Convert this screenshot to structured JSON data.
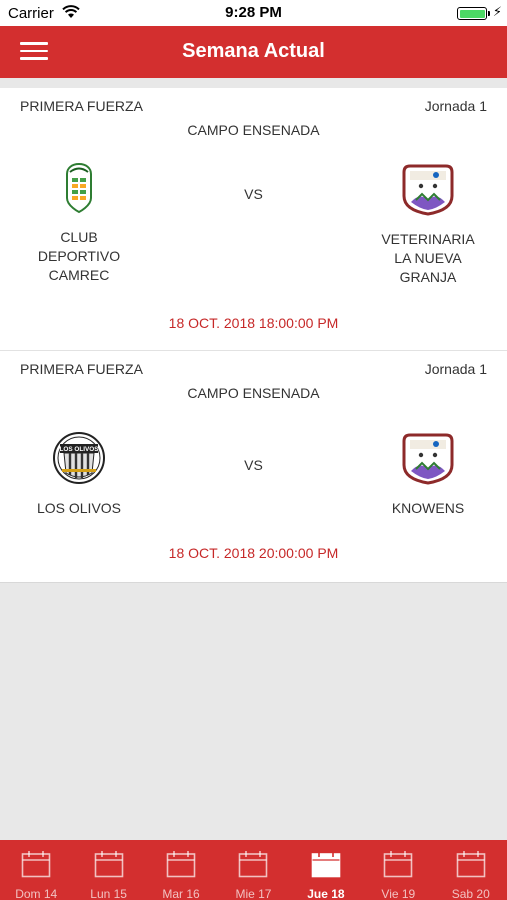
{
  "status_bar": {
    "carrier": "Carrier",
    "time": "9:28 PM",
    "wifi_icon": "wifi-icon",
    "battery_icon": "battery-icon",
    "battery_level": 1.0
  },
  "header": {
    "title": "Semana Actual",
    "menu_icon": "hamburger-menu-icon"
  },
  "colors": {
    "primary": "#d32f2f",
    "date_text": "#c62828",
    "background": "#e8e8e8",
    "battery": "#4cd964"
  },
  "matches": [
    {
      "division": "PRIMERA FUERZA",
      "round": "Jornada 1",
      "venue": "CAMPO ENSENADA",
      "home": {
        "name_lines": [
          "CLUB",
          "DEPORTIVO",
          "CAMREC"
        ],
        "logo": "club-crest-icon"
      },
      "vs": "VS",
      "away": {
        "name_lines": [
          "VETERINARIA",
          "LA NUEVA",
          "GRANJA"
        ],
        "logo": "club-crest-icon"
      },
      "datetime": "18 OCT. 2018 18:00:00 PM"
    },
    {
      "division": "PRIMERA FUERZA",
      "round": "Jornada 1",
      "venue": "CAMPO ENSENADA",
      "home": {
        "name_lines": [
          "LOS OLIVOS"
        ],
        "logo": "club-crest-icon",
        "logo_text": "LOS OLIVOS"
      },
      "vs": "VS",
      "away": {
        "name_lines": [
          "KNOWENS"
        ],
        "logo": "club-crest-icon"
      },
      "datetime": "18 OCT. 2018 20:00:00 PM"
    }
  ],
  "tabs": [
    {
      "label": "Dom 14",
      "icon": "calendar-icon",
      "active": false
    },
    {
      "label": "Lun 15",
      "icon": "calendar-icon",
      "active": false
    },
    {
      "label": "Mar 16",
      "icon": "calendar-icon",
      "active": false
    },
    {
      "label": "Mie 17",
      "icon": "calendar-icon",
      "active": false
    },
    {
      "label": "Jue 18",
      "icon": "calendar-icon",
      "active": true
    },
    {
      "label": "Vie 19",
      "icon": "calendar-icon",
      "active": false
    },
    {
      "label": "Sab 20",
      "icon": "calendar-icon",
      "active": false
    }
  ]
}
